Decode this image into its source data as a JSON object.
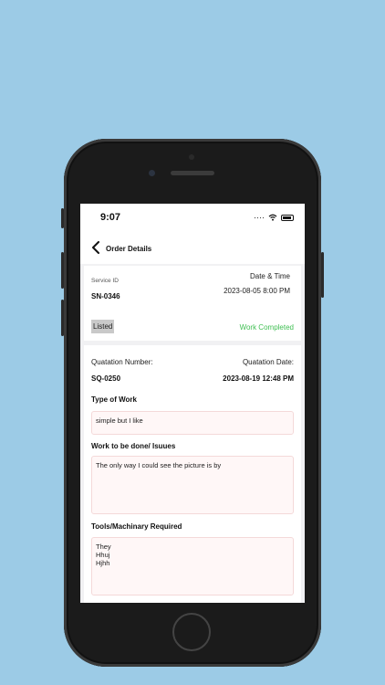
{
  "status_bar": {
    "time": "9:07",
    "signal": "····",
    "wifi_icon": "wifi-icon"
  },
  "nav": {
    "title": "Order Details"
  },
  "order": {
    "service_id_label": "Service ID",
    "service_id": "SN-0346",
    "datetime_label": "Date & Time",
    "datetime": "2023-08-05 8:00 PM",
    "status_listed": "Listed",
    "status_completed": "Work Completed"
  },
  "quotation": {
    "number_label": "Quatation Number:",
    "number": "SQ-0250",
    "date_label": "Quatation Date:",
    "date": "2023-08-19 12:48 PM",
    "type_title": "Type of Work",
    "type_value": "simple but I like",
    "work_title": "Work to be done/ Isuues",
    "work_value": "The only way I could see the picture is by",
    "tools_title": "Tools/Machinary Required",
    "tools_value": "They\nHhuj\nHjhh"
  },
  "colors": {
    "background": "#9ccbe6",
    "completed": "#3fbf52"
  }
}
